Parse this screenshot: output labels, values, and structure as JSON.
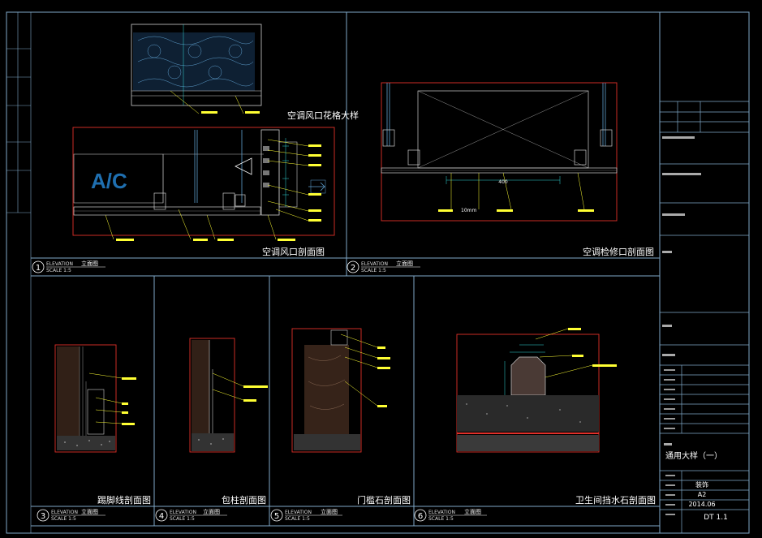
{
  "panels": [
    {
      "num": "1",
      "title": "空调风口剖面图",
      "tag": "ELEVATION",
      "tag_cn": "立面图",
      "scale": "SCALE 1:5"
    },
    {
      "num": "2",
      "title": "空调检修口剖面图",
      "tag": "ELEVATION",
      "tag_cn": "立面图",
      "scale": "SCALE 1:5"
    },
    {
      "num": "3",
      "title": "踢脚线剖面图",
      "tag": "ELEVATION",
      "tag_cn": "立面图",
      "scale": "SCALE 1:5"
    },
    {
      "num": "4",
      "title": "包柱剖面图",
      "tag": "ELEVATION",
      "tag_cn": "立面图",
      "scale": "SCALE 1:5"
    },
    {
      "num": "5",
      "title": "门槛石剖面图",
      "tag": "ELEVATION",
      "tag_cn": "立面图",
      "scale": "SCALE 1:5"
    },
    {
      "num": "6",
      "title": "卫生间挡水石剖面图",
      "tag": "ELEVATION",
      "tag_cn": "立面图",
      "scale": "SCALE 1:5"
    }
  ],
  "detail_titles": {
    "grille": "空调风口花格大样",
    "ac_label": "A/C",
    "dim_400": "400",
    "dim_10mm": "10mm"
  },
  "title_block": {
    "sheet_title": "通用大样（一）",
    "value_a": "装饰",
    "paper": "A2",
    "date": "2014.06",
    "drawing_no": "DT 1.1"
  },
  "colors": {
    "frame": "#7fa8c8",
    "detail_border": "#e0302a",
    "annotation": "#ffff33",
    "dimension": "#33d6d6",
    "accent_text": "#1f6fb0"
  }
}
